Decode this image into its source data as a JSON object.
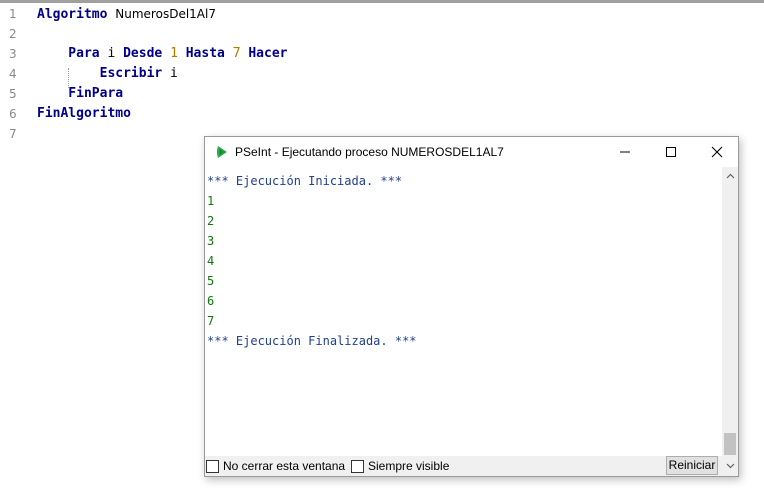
{
  "editor": {
    "lines": [
      {
        "num": "1",
        "tokens": [
          {
            "t": "Algoritmo",
            "k": "kw"
          },
          {
            "t": " ",
            "k": "id"
          },
          {
            "t": "NumerosDel1Al7",
            "k": "id"
          }
        ]
      },
      {
        "num": "2",
        "tokens": []
      },
      {
        "num": "3",
        "tokens": [
          {
            "t": "    Para",
            "k": "kw"
          },
          {
            "t": " i ",
            "k": "id"
          },
          {
            "t": "Desde",
            "k": "kw"
          },
          {
            "t": " ",
            "k": "id"
          },
          {
            "t": "1",
            "k": "num"
          },
          {
            "t": " ",
            "k": "id"
          },
          {
            "t": "Hasta",
            "k": "kw"
          },
          {
            "t": " ",
            "k": "id"
          },
          {
            "t": "7",
            "k": "num"
          },
          {
            "t": " ",
            "k": "id"
          },
          {
            "t": "Hacer",
            "k": "kw"
          }
        ]
      },
      {
        "num": "4",
        "tokens": [
          {
            "t": "        Escribir",
            "k": "kw"
          },
          {
            "t": " i",
            "k": "id"
          }
        ]
      },
      {
        "num": "5",
        "tokens": [
          {
            "t": "    FinPara",
            "k": "kw"
          }
        ]
      },
      {
        "num": "6",
        "tokens": [
          {
            "t": "FinAlgoritmo",
            "k": "kw"
          }
        ]
      },
      {
        "num": "7",
        "tokens": []
      }
    ]
  },
  "console": {
    "app_icon": "pseint-play-icon",
    "title": "PSeInt - Ejecutando proceso NUMEROSDEL1AL7",
    "output": [
      {
        "text": "*** Ejecución Iniciada. ***",
        "kind": "info"
      },
      {
        "text": "1",
        "kind": "value"
      },
      {
        "text": "2",
        "kind": "value"
      },
      {
        "text": "3",
        "kind": "value"
      },
      {
        "text": "4",
        "kind": "value"
      },
      {
        "text": "5",
        "kind": "value"
      },
      {
        "text": "6",
        "kind": "value"
      },
      {
        "text": "7",
        "kind": "value"
      },
      {
        "text": "*** Ejecución Finalizada. ***",
        "kind": "info"
      }
    ],
    "keep_open_label": "No cerrar esta ventana",
    "keep_open_checked": false,
    "always_visible_label": "Siempre visible",
    "always_visible_checked": false,
    "restart_label": "Reiniciar"
  },
  "colors": {
    "keyword": "#00008b",
    "number": "#b07a00",
    "info_output": "#1f3f8f",
    "value_output": "#0a7a0a",
    "icon_green": "#2aa84a"
  }
}
